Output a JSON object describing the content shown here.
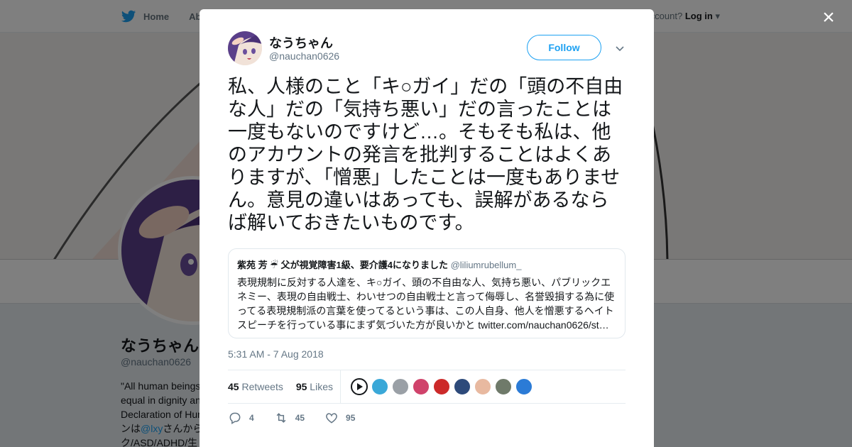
{
  "topbar": {
    "home_label": "Home",
    "about_label": "Abo",
    "account_prefix": "ccount?",
    "login_label": "Log in"
  },
  "background_profile": {
    "name": "なうちゃん",
    "handle": "@nauchan0626",
    "bio_lines": [
      "\"All human beings",
      "equal in dignity an",
      "Declaration of Hum",
      "ンは",
      "ク/ASD/ADHD/生"
    ],
    "bio_link": "@lxy",
    "bio_after_link": "さんから"
  },
  "modal": {
    "close_label": "×",
    "author": {
      "name": "なうちゃん",
      "handle": "@nauchan0626"
    },
    "follow_label": "Follow",
    "tweet_text": "私、人様のこと「キ○ガイ」だの「頭の不自由な人」だの「気持ち悪い」だの言ったことは一度もないのですけど…。そもそも私は、他のアカウントの発言を批判することはよくありますが、「憎悪」したことは一度もありません。意見の違いはあっても、誤解があるならば解いておきたいものです。",
    "quote": {
      "name": "紫苑 芳 ☔ 父が視覚障害1級、要介護4になりました",
      "handle": "@liliumrubellum_",
      "body": "表現規制に反対する人達を、キ○ガイ、頭の不自由な人、気持ち悪い、パブリックエネミー、表現の自由戦士、わいせつの自由戦士と言って侮辱し、名誉毀損する為に使ってる表現規制派の言葉を使ってるという事は、この人自身、他人を憎悪するヘイトスピーチを行っている事にまず気づいた方が良いかと",
      "link": "twitter.com/nauchan0626/st…"
    },
    "timestamp": "5:31 AM - 7 Aug 2018",
    "stats": {
      "retweets_count": "45",
      "retweets_label": "Retweets",
      "likes_count": "95",
      "likes_label": "Likes"
    },
    "likers_colors": [
      "#3aa8d8",
      "#9aa0a6",
      "#d0436b",
      "#cc2a2a",
      "#2d4a7a",
      "#e8b9a0",
      "#6f7a6a",
      "#2b7bd6"
    ],
    "actions": {
      "reply_count": "4",
      "retweet_count": "45",
      "like_count": "95"
    }
  },
  "colors": {
    "accent": "#1da1f2",
    "text": "#14171a",
    "muted": "#657786"
  }
}
